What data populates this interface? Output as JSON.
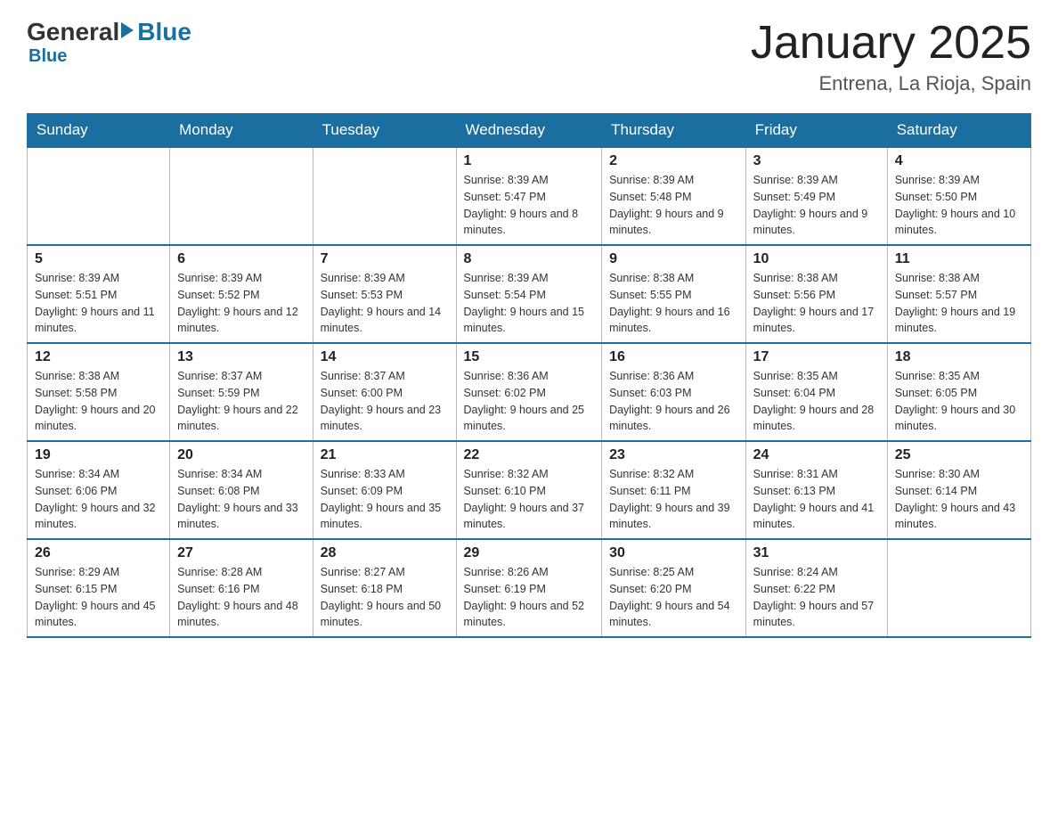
{
  "header": {
    "logo": {
      "general": "General",
      "blue": "Blue"
    },
    "title": "January 2025",
    "location": "Entrena, La Rioja, Spain"
  },
  "days_of_week": [
    "Sunday",
    "Monday",
    "Tuesday",
    "Wednesday",
    "Thursday",
    "Friday",
    "Saturday"
  ],
  "weeks": [
    [
      {
        "day": "",
        "info": ""
      },
      {
        "day": "",
        "info": ""
      },
      {
        "day": "",
        "info": ""
      },
      {
        "day": "1",
        "info": "Sunrise: 8:39 AM\nSunset: 5:47 PM\nDaylight: 9 hours and 8 minutes."
      },
      {
        "day": "2",
        "info": "Sunrise: 8:39 AM\nSunset: 5:48 PM\nDaylight: 9 hours and 9 minutes."
      },
      {
        "day": "3",
        "info": "Sunrise: 8:39 AM\nSunset: 5:49 PM\nDaylight: 9 hours and 9 minutes."
      },
      {
        "day": "4",
        "info": "Sunrise: 8:39 AM\nSunset: 5:50 PM\nDaylight: 9 hours and 10 minutes."
      }
    ],
    [
      {
        "day": "5",
        "info": "Sunrise: 8:39 AM\nSunset: 5:51 PM\nDaylight: 9 hours and 11 minutes."
      },
      {
        "day": "6",
        "info": "Sunrise: 8:39 AM\nSunset: 5:52 PM\nDaylight: 9 hours and 12 minutes."
      },
      {
        "day": "7",
        "info": "Sunrise: 8:39 AM\nSunset: 5:53 PM\nDaylight: 9 hours and 14 minutes."
      },
      {
        "day": "8",
        "info": "Sunrise: 8:39 AM\nSunset: 5:54 PM\nDaylight: 9 hours and 15 minutes."
      },
      {
        "day": "9",
        "info": "Sunrise: 8:38 AM\nSunset: 5:55 PM\nDaylight: 9 hours and 16 minutes."
      },
      {
        "day": "10",
        "info": "Sunrise: 8:38 AM\nSunset: 5:56 PM\nDaylight: 9 hours and 17 minutes."
      },
      {
        "day": "11",
        "info": "Sunrise: 8:38 AM\nSunset: 5:57 PM\nDaylight: 9 hours and 19 minutes."
      }
    ],
    [
      {
        "day": "12",
        "info": "Sunrise: 8:38 AM\nSunset: 5:58 PM\nDaylight: 9 hours and 20 minutes."
      },
      {
        "day": "13",
        "info": "Sunrise: 8:37 AM\nSunset: 5:59 PM\nDaylight: 9 hours and 22 minutes."
      },
      {
        "day": "14",
        "info": "Sunrise: 8:37 AM\nSunset: 6:00 PM\nDaylight: 9 hours and 23 minutes."
      },
      {
        "day": "15",
        "info": "Sunrise: 8:36 AM\nSunset: 6:02 PM\nDaylight: 9 hours and 25 minutes."
      },
      {
        "day": "16",
        "info": "Sunrise: 8:36 AM\nSunset: 6:03 PM\nDaylight: 9 hours and 26 minutes."
      },
      {
        "day": "17",
        "info": "Sunrise: 8:35 AM\nSunset: 6:04 PM\nDaylight: 9 hours and 28 minutes."
      },
      {
        "day": "18",
        "info": "Sunrise: 8:35 AM\nSunset: 6:05 PM\nDaylight: 9 hours and 30 minutes."
      }
    ],
    [
      {
        "day": "19",
        "info": "Sunrise: 8:34 AM\nSunset: 6:06 PM\nDaylight: 9 hours and 32 minutes."
      },
      {
        "day": "20",
        "info": "Sunrise: 8:34 AM\nSunset: 6:08 PM\nDaylight: 9 hours and 33 minutes."
      },
      {
        "day": "21",
        "info": "Sunrise: 8:33 AM\nSunset: 6:09 PM\nDaylight: 9 hours and 35 minutes."
      },
      {
        "day": "22",
        "info": "Sunrise: 8:32 AM\nSunset: 6:10 PM\nDaylight: 9 hours and 37 minutes."
      },
      {
        "day": "23",
        "info": "Sunrise: 8:32 AM\nSunset: 6:11 PM\nDaylight: 9 hours and 39 minutes."
      },
      {
        "day": "24",
        "info": "Sunrise: 8:31 AM\nSunset: 6:13 PM\nDaylight: 9 hours and 41 minutes."
      },
      {
        "day": "25",
        "info": "Sunrise: 8:30 AM\nSunset: 6:14 PM\nDaylight: 9 hours and 43 minutes."
      }
    ],
    [
      {
        "day": "26",
        "info": "Sunrise: 8:29 AM\nSunset: 6:15 PM\nDaylight: 9 hours and 45 minutes."
      },
      {
        "day": "27",
        "info": "Sunrise: 8:28 AM\nSunset: 6:16 PM\nDaylight: 9 hours and 48 minutes."
      },
      {
        "day": "28",
        "info": "Sunrise: 8:27 AM\nSunset: 6:18 PM\nDaylight: 9 hours and 50 minutes."
      },
      {
        "day": "29",
        "info": "Sunrise: 8:26 AM\nSunset: 6:19 PM\nDaylight: 9 hours and 52 minutes."
      },
      {
        "day": "30",
        "info": "Sunrise: 8:25 AM\nSunset: 6:20 PM\nDaylight: 9 hours and 54 minutes."
      },
      {
        "day": "31",
        "info": "Sunrise: 8:24 AM\nSunset: 6:22 PM\nDaylight: 9 hours and 57 minutes."
      },
      {
        "day": "",
        "info": ""
      }
    ]
  ]
}
